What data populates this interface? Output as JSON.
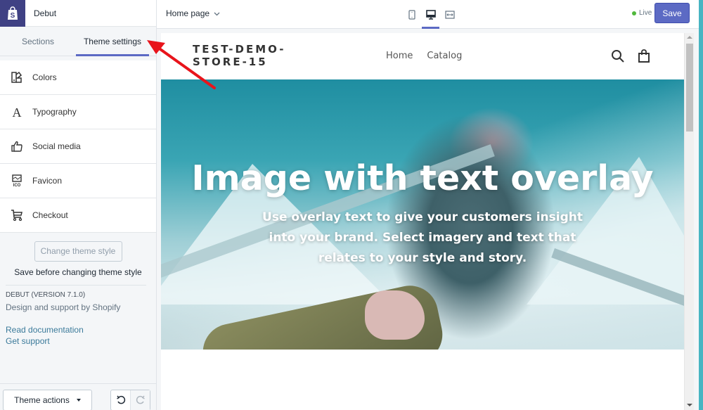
{
  "app": {
    "theme_name": "Debut",
    "logo_icon": "shopify-bag-icon"
  },
  "sidebar": {
    "tabs": [
      {
        "label": "Sections",
        "active": false
      },
      {
        "label": "Theme settings",
        "active": true
      }
    ],
    "items": [
      {
        "label": "Colors",
        "icon": "colors-palette-icon"
      },
      {
        "label": "Typography",
        "icon": "typography-icon"
      },
      {
        "label": "Social media",
        "icon": "thumbs-up-icon"
      },
      {
        "label": "Favicon",
        "icon": "favicon-ico-icon"
      },
      {
        "label": "Checkout",
        "icon": "cart-icon"
      }
    ],
    "change_style_button": "Change theme style",
    "change_style_note": "Save before changing theme style",
    "theme_version": "DEBUT (VERSION 7.1.0)",
    "theme_support": "Design and support by Shopify",
    "links": [
      "Read documentation",
      "Get support"
    ],
    "footer": {
      "theme_actions": "Theme actions",
      "undo_icon": "undo-icon",
      "redo_icon": "redo-icon"
    }
  },
  "topbar": {
    "page_selector": "Home page",
    "devices": [
      {
        "name": "mobile",
        "active": false
      },
      {
        "name": "desktop",
        "active": true
      },
      {
        "name": "fullscreen",
        "active": false
      }
    ],
    "status": "Live",
    "save_label": "Save"
  },
  "preview": {
    "store_name_line1": "TEST-DEMO-",
    "store_name_line2": "STORE-15",
    "nav": [
      "Home",
      "Catalog"
    ],
    "hero_title": "Image with text overlay",
    "hero_text": "Use overlay text to give your customers insight into your brand. Select imagery and text that relates to your style and story."
  },
  "colors": {
    "accent": "#5c6ac4",
    "brand_dark": "#3f4184",
    "live": "#50b83c",
    "annotation_arrow": "#e8141b"
  }
}
